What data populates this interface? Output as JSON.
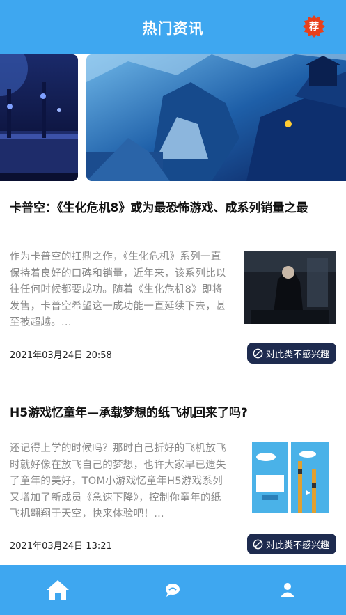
{
  "header": {
    "title": "热门资讯",
    "badge": "荐"
  },
  "articles": [
    {
      "title": "卡普空：《生化危机8》或为最恐怖游戏、成系列销量之最",
      "summary": "作为卡普空的扛鼎之作，《生化危机》系列一直保持着良好的口碑和销量，近年来，该系列比以往任何时候都要成功。随着《生化危机8》即将发售，卡普空希望这一成功能一直延续下去，甚至被超越。...",
      "time": "2021年03月24日  20:58",
      "dislike_label": "对此类不感兴趣"
    },
    {
      "title": "H5游戏忆童年—承载梦想的纸飞机回来了吗?",
      "summary": "还记得上学的时候吗？那时自己折好的飞机放飞时就好像在放飞自己的梦想，也许大家早已遗失了童年的美好，TOM小游戏忆童年H5游戏系列又增加了新成员《急速下降》，控制你童年的纸飞机翱翔于天空，快来体验吧！...",
      "time": "2021年03月24日  13:21",
      "dislike_label": "对此类不感兴趣"
    }
  ],
  "tabbar": {
    "items": [
      "home-icon",
      "chat-icon",
      "user-icon"
    ]
  },
  "colors": {
    "primary": "#3ea7f0",
    "button": "#1e2b4f",
    "badge": "#e8401c"
  }
}
